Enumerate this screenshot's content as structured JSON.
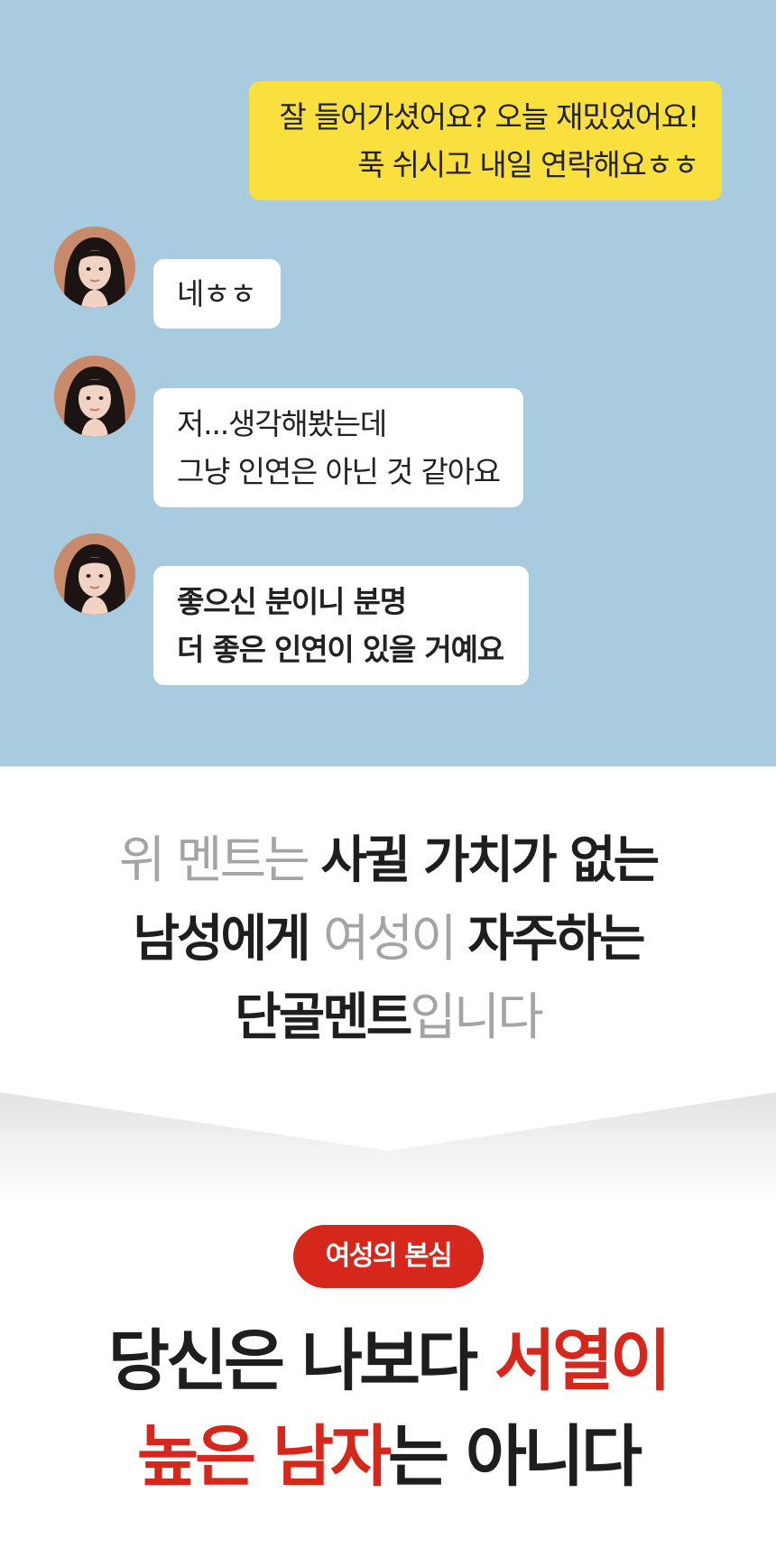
{
  "chat": {
    "background": "#a8cbe0",
    "sent": {
      "color": "#f9e03f",
      "line1": "잘 들어가셨어요? 오늘 재밌었어요!",
      "line2": "푹 쉬시고 내일 연락해요ㅎㅎ"
    },
    "received": [
      {
        "line1": "네ㅎㅎ"
      },
      {
        "line1": "저...생각해봤는데",
        "line2": "그냥 인연은 아닌 것 같아요"
      },
      {
        "line1": "좋으신 분이니 분명",
        "line2": "더 좋은 인연이 있을 거예요"
      }
    ]
  },
  "headline": {
    "l1_gray": "위 멘트는 ",
    "l1_bold": "사귈 가치가 없는",
    "l2_bold": "남성에게 ",
    "l2_gray": "여성이 ",
    "l2_bold2": "자주하는",
    "l3_bold": "단골멘트",
    "l3_gray": "입니다"
  },
  "badge": {
    "label": "여성의 본심",
    "color": "#d5271c"
  },
  "conclusion": {
    "l1_dark": "당신은 나보다 ",
    "l1_red": "서열이",
    "l2_red": "높은 남자",
    "l2_dark": "는 아니다"
  }
}
